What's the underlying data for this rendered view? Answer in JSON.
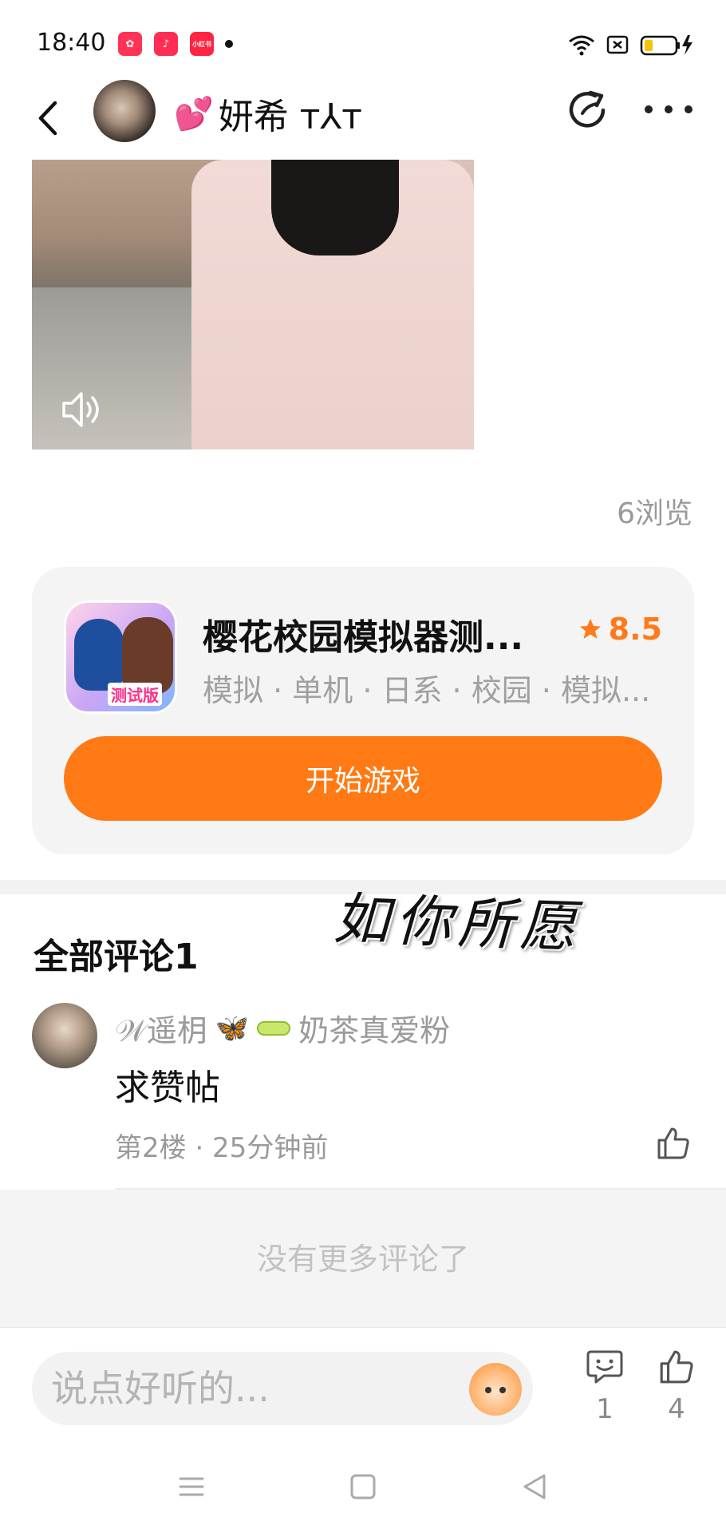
{
  "status_bar": {
    "time": "18:40",
    "app_badges": [
      {
        "name": "app-badge-1",
        "color": "#ff3355",
        "glyph": "✿"
      },
      {
        "name": "app-badge-2",
        "color": "#ff2d55",
        "glyph": "♪"
      },
      {
        "name": "app-badge-3",
        "color": "#ff2442",
        "glyph": "小红书"
      }
    ]
  },
  "header": {
    "nickname": "妍希 ᴛ⅄ᴛ",
    "heart_glyph": "💕"
  },
  "post": {
    "views": "6浏览"
  },
  "game_card": {
    "title": "樱花校园模拟器测...",
    "rating": "8.5",
    "tags": "模拟 · 单机 · 日系 · 校园 · 模拟...",
    "icon_tag": "测试版",
    "play_label": "开始游戏",
    "accent_color": "#ff7a14"
  },
  "comments": {
    "title": "全部评论1",
    "overlay_text": "如你所愿",
    "items": [
      {
        "username": "𝒲遥枂",
        "fan_label": "奶茶真爱粉",
        "text": "求赞帖",
        "meta": "第2楼 · 25分钟前"
      }
    ],
    "no_more": "没有更多评论了"
  },
  "input_bar": {
    "placeholder": "说点好听的...",
    "comment_count": "1",
    "like_count": "4"
  },
  "icons": [
    "back-arrow-icon",
    "share-icon",
    "more-icon",
    "sound-icon",
    "star-icon",
    "like-icon",
    "comment-icon",
    "emoji-icon",
    "wifi-icon",
    "battery-icon"
  ]
}
